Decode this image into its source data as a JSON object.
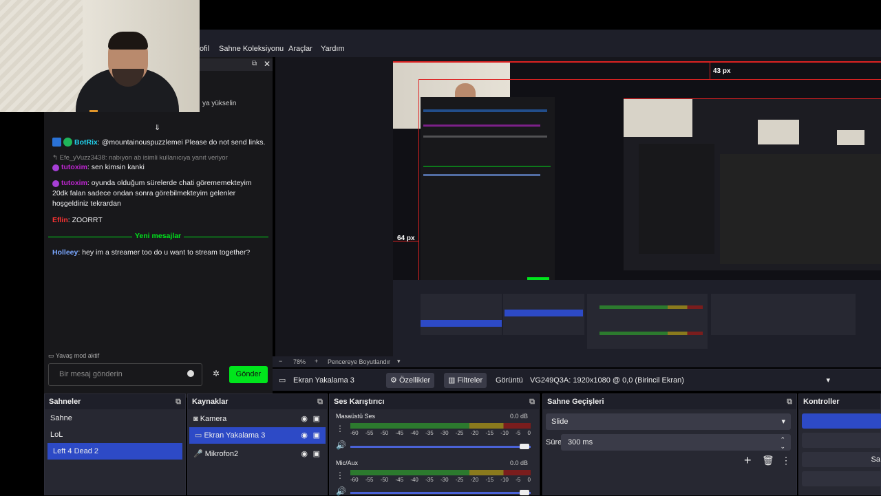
{
  "menu": {
    "items": [
      "ofil",
      "Sahne Koleksiyonu",
      "Araçlar",
      "Yardım"
    ]
  },
  "chat": {
    "header_fragment": "ya yükselin",
    "messages": [
      {
        "user": "BotRix",
        "text": "@mountainouspuzzlemei Please do not send links.",
        "color": "#22d3ee"
      },
      {
        "user": "Efe_yVuzz3438",
        "text": "nabıyon ab isimli kullanıcıya yanıt veriyor",
        "color": "#888"
      },
      {
        "user": "tutoxim",
        "text": "sen kimsin kanki",
        "color": "#c026d3"
      },
      {
        "user": "tutoxim",
        "text": "oyunda olduğum sürelerde chati görememekteyim 20dk falan sadece ondan sonra görebilmekteyim gelenler hoşgeldiniz tekrardan",
        "color": "#c026d3"
      },
      {
        "user": "Eflin",
        "text": "ZOORRT",
        "color": "#ff3333"
      },
      {
        "user": "Holleey",
        "text": "hey im a streamer too do u want to stream together?",
        "color": "#7aa7ff"
      }
    ],
    "new_messages": "Yeni mesajlar",
    "slow_mode": "Yavaş mod aktif",
    "input_placeholder": "Bir mesaj gönderin",
    "send_label": "Gönder"
  },
  "preview": {
    "px_top": "43 px",
    "px_left": "64 px"
  },
  "zoom": {
    "minus": "−",
    "value": "78%",
    "plus": "+",
    "fit": "Pencereye Boyutlandır"
  },
  "source_bar": {
    "source_name": "Ekran Yakalama 3",
    "properties": "Özellikler",
    "filters": "Filtreler",
    "display_label": "Görüntü",
    "display_value": "VG249Q3A: 1920x1080 @ 0,0 (Birincil Ekran)"
  },
  "scenes": {
    "title": "Sahneler",
    "items": [
      "Sahne",
      "LoL",
      "Left 4 Dead 2"
    ],
    "selected": 2
  },
  "sources": {
    "title": "Kaynaklar",
    "items": [
      {
        "name": "Kamera",
        "icon": "camera-icon"
      },
      {
        "name": "Ekran Yakalama 3",
        "icon": "monitor-icon"
      },
      {
        "name": "Mikrofon2",
        "icon": "microphone-icon"
      }
    ],
    "selected": 1
  },
  "mixer": {
    "title": "Ses Karıştırıcı",
    "channels": [
      {
        "name": "Masaüstü Ses",
        "db": "0.0 dB"
      },
      {
        "name": "Mic/Aux",
        "db": "0.0 dB"
      }
    ],
    "ticks": [
      "-60",
      "-55",
      "-50",
      "-45",
      "-40",
      "-35",
      "-30",
      "-25",
      "-20",
      "-15",
      "-10",
      "-5",
      "0"
    ]
  },
  "transitions": {
    "title": "Sahne Geçişleri",
    "type": "Slide",
    "duration_label": "Süre",
    "duration": "300 ms"
  },
  "controls": {
    "title": "Kontroller",
    "partial": "Sa"
  }
}
